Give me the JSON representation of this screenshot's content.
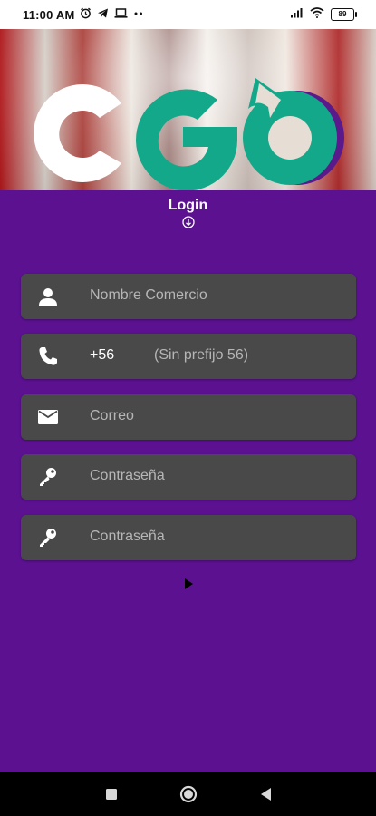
{
  "status_bar": {
    "time": "11:00 AM",
    "battery": "89",
    "left_icons": [
      "alarm-icon",
      "telegram-icon",
      "laptop-icon",
      "more-dots-icon"
    ],
    "right_icons": [
      "signal-icon",
      "wifi-icon",
      "battery-icon"
    ]
  },
  "header": {
    "logo_text": "CGO",
    "login_label": "Login"
  },
  "form": {
    "business_name_placeholder": "Nombre Comercio",
    "phone_prefix": "+56",
    "phone_placeholder": "(Sin prefijo 56)",
    "email_placeholder": "Correo",
    "password_placeholder": "Contraseña",
    "confirm_password_placeholder": "Contraseña"
  },
  "colors": {
    "background": "#5b1190",
    "field": "#494949",
    "logo_green": "#13a88a",
    "logo_purple": "#5a1a8c",
    "logo_white": "#ffffff"
  },
  "navigation": [
    "recent-apps-button",
    "home-button",
    "back-button"
  ]
}
